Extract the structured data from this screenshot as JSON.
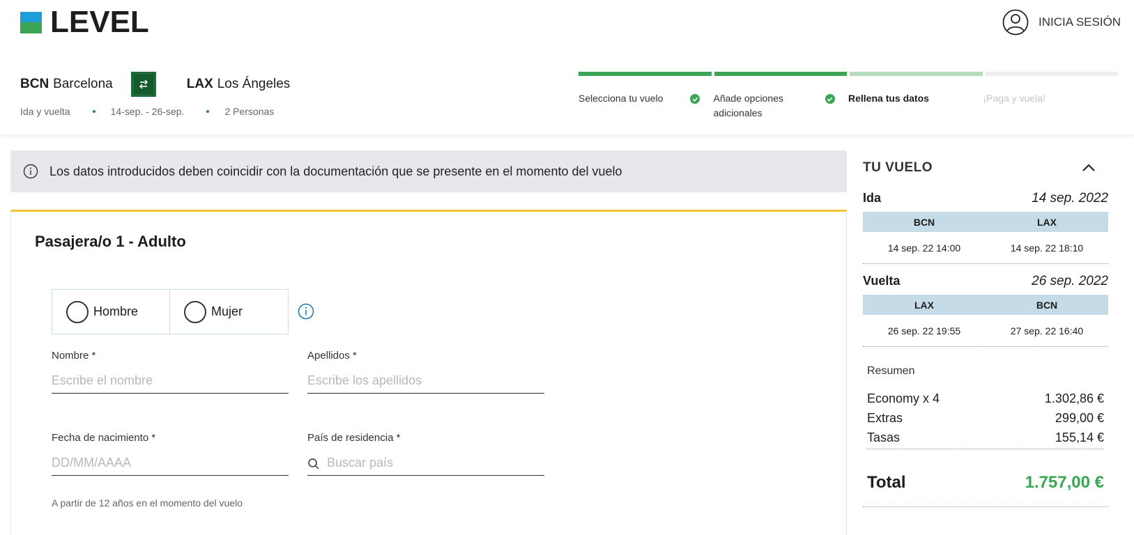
{
  "brand": {
    "name": "LEVEL"
  },
  "header": {
    "login_label": "INICIA SESIÓN",
    "route": {
      "origin_code": "BCN",
      "origin_city": "Barcelona",
      "destination_code": "LAX",
      "destination_city": "Los Ángeles"
    },
    "trip": {
      "type": "Ida y vuelta",
      "dates": "14-sep. - 26-sep.",
      "passengers": "2 Personas"
    }
  },
  "steps": [
    {
      "label": "Selecciona tu vuelo",
      "state": "done",
      "bar_color": "#3aa655",
      "text_color": "#333333"
    },
    {
      "label": "Añade opciones adicionales",
      "state": "done",
      "bar_color": "#3aa655",
      "text_color": "#333333"
    },
    {
      "label": "Rellena tus datos",
      "state": "current",
      "bar_color": "#b3dcbd",
      "text_color": "#1d1d1b"
    },
    {
      "label": "¡Paga y vuela!",
      "state": "pending",
      "bar_color": "#eeeeee",
      "text_color": "#c4c4c4"
    }
  ],
  "notice": {
    "text": "Los datos introducidos deben coincidir con la documentación que se presente en el momento del vuelo"
  },
  "passenger_form": {
    "title": "Pasajera/o 1 - Adulto",
    "gender_options": [
      "Hombre",
      "Mujer"
    ],
    "first_name": {
      "label": "Nombre *",
      "placeholder": "Escribe el nombre",
      "value": ""
    },
    "last_name": {
      "label": "Apellidos *",
      "placeholder": "Escribe los apellidos",
      "value": ""
    },
    "birth_date": {
      "label": "Fecha de nacimiento *",
      "placeholder": "DD/MM/AAAA",
      "value": ""
    },
    "country": {
      "label": "País de residencia *",
      "placeholder": "Buscar país",
      "value": ""
    },
    "birth_hint": "A partir de 12 años en el momento del vuelo"
  },
  "summary": {
    "title": "TU VUELO",
    "outbound": {
      "label": "Ida",
      "date": "14 sep. 2022",
      "from": "BCN",
      "to": "LAX",
      "depart": "14 sep. 22 14:00",
      "arrive": "14 sep. 22 18:10"
    },
    "inbound": {
      "label": "Vuelta",
      "date": "26 sep. 2022",
      "from": "LAX",
      "to": "BCN",
      "depart": "26 sep. 22 19:55",
      "arrive": "27 sep. 22 16:40"
    },
    "resume_title": "Resumen",
    "lines": [
      {
        "label": "Economy x 4",
        "amount": "1.302,86 €"
      },
      {
        "label": "Extras",
        "amount": "299,00 €"
      },
      {
        "label": "Tasas",
        "amount": "155,14 €"
      }
    ],
    "total_label": "Total",
    "total_amount": "1.757,00 €"
  },
  "colors": {
    "brand_green": "#3aa655",
    "brand_blue": "#1f9fd9",
    "swap_bg": "#1e6b3a",
    "notice_bg": "#e8e8ec",
    "card_accent": "#f2c230",
    "leg_header_bg": "#c5dce8",
    "info_icon": "#1a75b3"
  }
}
